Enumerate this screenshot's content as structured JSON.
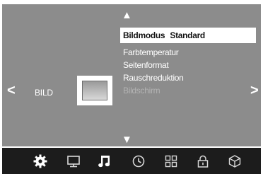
{
  "navigation": {
    "up_glyph": "▲",
    "down_glyph": "▼",
    "left_glyph": "<",
    "right_glyph": ">"
  },
  "category": {
    "label": "BILD",
    "icon": "picture-icon"
  },
  "menu": {
    "items": [
      {
        "label": "Bildmodus",
        "value": "Standard",
        "state": "selected"
      },
      {
        "label": "Farbtemperatur",
        "state": "normal"
      },
      {
        "label": "Seitenformat",
        "state": "normal"
      },
      {
        "label": "Rauschreduktion",
        "state": "normal"
      },
      {
        "label": "Bildschirm",
        "state": "disabled"
      }
    ]
  },
  "bottom_bar": {
    "icons": [
      {
        "name": "settings-gear-icon",
        "active": true
      },
      {
        "name": "picture-monitor-icon",
        "active": false
      },
      {
        "name": "music-note-icon",
        "active": false
      },
      {
        "name": "clock-icon",
        "active": false
      },
      {
        "name": "options-grid-icon",
        "active": false
      },
      {
        "name": "lock-icon",
        "active": false
      },
      {
        "name": "cube-icon",
        "active": false
      }
    ]
  },
  "colors": {
    "panel": "#8c8c8c",
    "bottom_bar": "#1c1c1c",
    "selected_bg": "#ffffff",
    "disabled_text": "#b3b3b3"
  }
}
